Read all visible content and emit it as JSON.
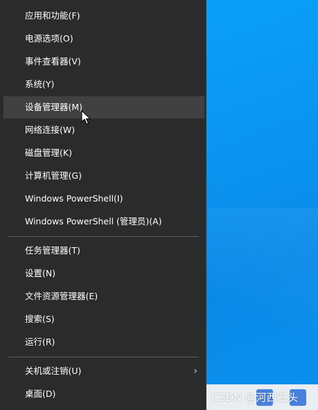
{
  "menu": {
    "items": [
      {
        "label": "应用和功能(F)"
      },
      {
        "label": "电源选项(O)"
      },
      {
        "label": "事件查看器(V)"
      },
      {
        "label": "系统(Y)"
      },
      {
        "label": "设备管理器(M)"
      },
      {
        "label": "网络连接(W)"
      },
      {
        "label": "磁盘管理(K)"
      },
      {
        "label": "计算机管理(G)"
      },
      {
        "label": "Windows PowerShell(I)"
      },
      {
        "label": "Windows PowerShell (管理员)(A)"
      },
      {
        "label": "任务管理器(T)"
      },
      {
        "label": "设置(N)"
      },
      {
        "label": "文件资源管理器(E)"
      },
      {
        "label": "搜索(S)"
      },
      {
        "label": "运行(R)"
      },
      {
        "label": "关机或注销(U)"
      },
      {
        "label": "桌面(D)"
      }
    ],
    "hovered_item": "设备管理器(M)",
    "submenu_indicator": "›"
  },
  "watermark": {
    "text": "CSDN @河西石头"
  },
  "colors": {
    "menu_background": "#2b2b2b",
    "menu_hover": "#414141",
    "menu_text": "#ffffff",
    "separator": "#5a5a5a",
    "desktop": "#0a96f2"
  }
}
